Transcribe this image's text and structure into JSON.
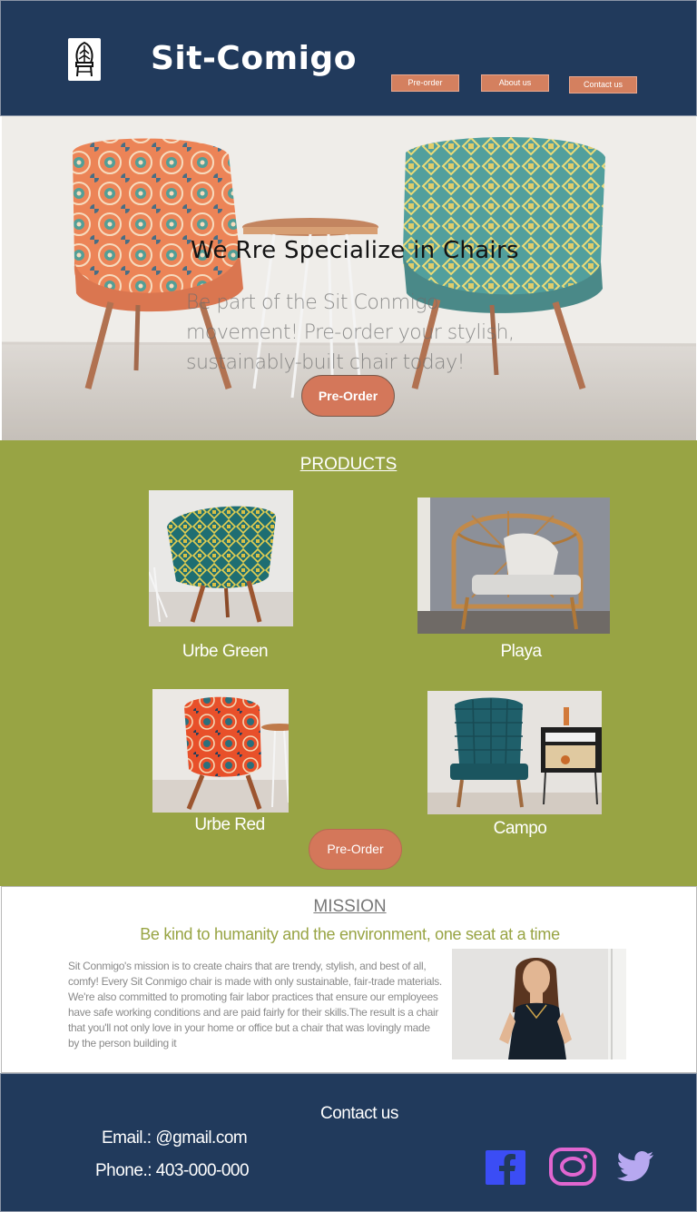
{
  "header": {
    "brand": "Sit-Comigo",
    "nav": {
      "preorder": "Pre-order",
      "about": "About us",
      "contact": "Contact us"
    }
  },
  "hero": {
    "title": "We Rre Specialize in Chairs",
    "subtitle": "Be part of the Sit Conmigo movement! Pre-order your stylish, sustainably-built chair today!",
    "button": "Pre-Order"
  },
  "products": {
    "title": "PRODUCTS",
    "items": [
      {
        "name": "Urbe Green"
      },
      {
        "name": "Playa"
      },
      {
        "name": "Urbe Red"
      },
      {
        "name": "Campo"
      }
    ],
    "button": "Pre-Order"
  },
  "mission": {
    "title": "MISSION",
    "tagline": "Be kind to humanity and the environment, one seat at a time",
    "text": "Sit Conmigo's mission is to create chairs that are trendy, stylish, and best of all, comfy! Every Sit Conmigo chair is made with only sustainable, fair-trade materials. We're also committed to promoting fair labor practices that ensure our employees have safe working conditions and are paid fairly for their skills.The result is a chair that you'll not only love in your home or office but a chair that was lovingly made by the person building it"
  },
  "footer": {
    "contact_title": "Contact us",
    "email": "Email.: @gmail.com",
    "phone": "Phone.: 403-000-000"
  },
  "colors": {
    "navy": "#213a5c",
    "olive": "#98a444",
    "terracotta": "#d4775a",
    "facebook": "#3b4df5",
    "instagram": "#e066d0",
    "twitter": "#b7a8f0"
  }
}
